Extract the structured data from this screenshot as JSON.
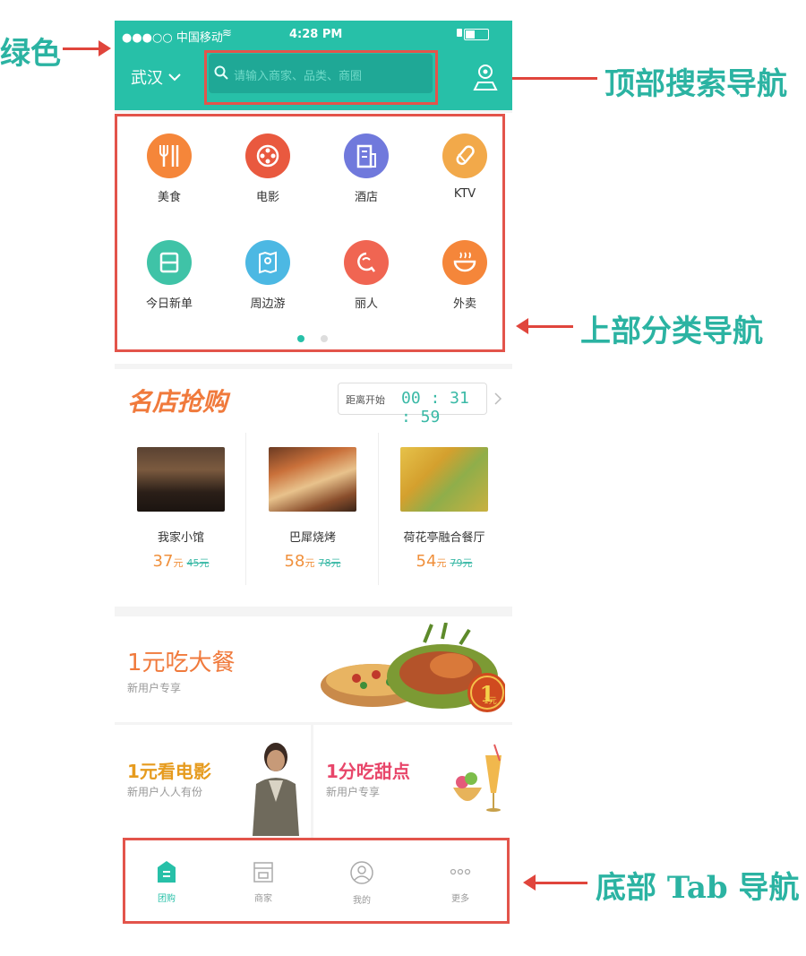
{
  "annotations": {
    "green": "绿色",
    "top_search_nav": "顶部搜索导航",
    "category_nav": "上部分类导航",
    "bottom_tab_nav": "底部 Tab 导航"
  },
  "status_bar": {
    "carrier": "●●●○○ 中国移动",
    "time": "4:28 PM"
  },
  "header": {
    "city": "武汉",
    "search_placeholder": "请输入商家、品类、商圈"
  },
  "categories": [
    {
      "label": "美食",
      "color": "#f5863a",
      "icon": "fork-knife-icon"
    },
    {
      "label": "电影",
      "color": "#e9593f",
      "icon": "film-reel-icon"
    },
    {
      "label": "酒店",
      "color": "#7079dc",
      "icon": "building-icon"
    },
    {
      "label": "KTV",
      "color": "#f2a94a",
      "icon": "microphone-icon"
    },
    {
      "label": "今日新单",
      "color": "#3fc3a7",
      "icon": "new-deal-icon"
    },
    {
      "label": "周边游",
      "color": "#4cb8e3",
      "icon": "map-icon"
    },
    {
      "label": "丽人",
      "color": "#f06552",
      "icon": "beauty-icon"
    },
    {
      "label": "外卖",
      "color": "#f5863a",
      "icon": "bowl-icon"
    }
  ],
  "flash_sale": {
    "title": "名店抢购",
    "countdown_label": "距离开始",
    "countdown": "00 : 31 : 59",
    "items": [
      {
        "name": "我家小馆",
        "price": "37",
        "unit": "元",
        "original": "45元"
      },
      {
        "name": "巴犀烧烤",
        "price": "58",
        "unit": "元",
        "original": "78元"
      },
      {
        "name": "荷花亭融合餐厅",
        "price": "54",
        "unit": "元",
        "original": "79元"
      }
    ]
  },
  "promos": {
    "main": {
      "title": "1元吃大餐",
      "subtitle": "新用户专享",
      "badge": "1元"
    },
    "left": {
      "title": "1元看电影",
      "subtitle": "新用户人人有份"
    },
    "right": {
      "title": "1分吃甜点",
      "subtitle": "新用户专享"
    }
  },
  "tabs": [
    {
      "label": "团购",
      "active": true
    },
    {
      "label": "商家",
      "active": false
    },
    {
      "label": "我的",
      "active": false
    },
    {
      "label": "更多",
      "active": false
    }
  ],
  "colors": {
    "brand_green": "#27c0a8",
    "annotation_red": "#e3544b",
    "annotation_text": "#2bb3a2"
  }
}
